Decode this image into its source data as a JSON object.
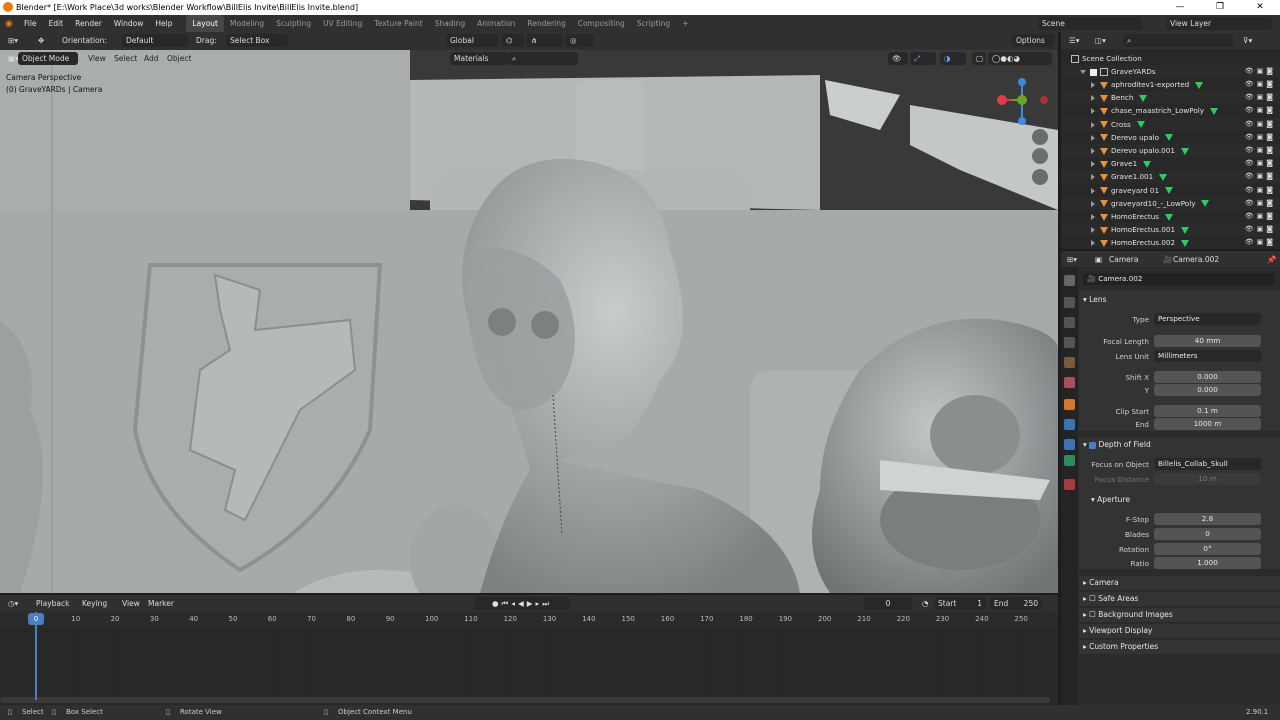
{
  "window": {
    "title": "Blender* [E:\\Work Place\\3d works\\Blender Workflow\\BillElis Invite\\BillElis Invite.blend]",
    "controls": [
      "—",
      "❐",
      "✕"
    ]
  },
  "menubar": {
    "menus": [
      "File",
      "Edit",
      "Render",
      "Window",
      "Help"
    ],
    "workspaces": [
      "Layout",
      "Modeling",
      "Sculpting",
      "UV Editing",
      "Texture Paint",
      "Shading",
      "Animation",
      "Rendering",
      "Compositing",
      "Scripting"
    ],
    "active_workspace": "Layout",
    "add_tab": "+",
    "scene": "Scene",
    "view_layer": "View Layer"
  },
  "viewport_header": {
    "orientation_label": "Orientation:",
    "orientation_value": "Default",
    "drag_label": "Drag:",
    "drag_value": "Select Box",
    "transform_orientation": "Global",
    "options": "Options",
    "mode": "Object Mode",
    "menus": [
      "View",
      "Select",
      "Add",
      "Object"
    ],
    "materials": "Materials"
  },
  "viewport": {
    "info_line1": "Camera Perspective",
    "info_line2": "(0) GraveYARDs | Camera",
    "gizmo_colors": {
      "x": "#e23b47",
      "y": "#6aa81f",
      "z": "#3b8be0"
    }
  },
  "outliner": {
    "root": "Scene Collection",
    "collection": "GraveYARDs",
    "items": [
      "aphroditev1-exported",
      "Bench",
      "chase_maastrich_LowPoly",
      "Cross",
      "Derevo upalo",
      "Derevo upalo.001",
      "Grave1",
      "Grave1.001",
      "graveyard 01",
      "graveyard10_-_LowPoly",
      "HomoErectus",
      "HomoErectus.001",
      "HomoErectus.002"
    ],
    "icon_color": "#e8903a",
    "mesh_color": "#2ccd5e"
  },
  "properties": {
    "breadcrumb_object": "Camera",
    "breadcrumb_data": "Camera.002",
    "datablock": "Camera.002",
    "lens_section": "Lens",
    "type_label": "Type",
    "type_value": "Perspective",
    "focal_label": "Focal Length",
    "focal_value": "40 mm",
    "lens_unit_label": "Lens Unit",
    "lens_unit_value": "Millimeters",
    "shift_x_label": "Shift X",
    "shift_x_value": "0.000",
    "shift_y_label": "Y",
    "shift_y_value": "0.000",
    "clip_start_label": "Clip Start",
    "clip_start_value": "0.1 m",
    "clip_end_label": "End",
    "clip_end_value": "1000 m",
    "dof_section": "Depth of Field",
    "focus_object_label": "Focus on Object",
    "focus_object_value": "Billelis_Collab_Skull",
    "focus_distance_label": "Focus Distance",
    "focus_distance_value": "10 m",
    "aperture_section": "Aperture",
    "fstop_label": "F-Stop",
    "fstop_value": "2.8",
    "blades_label": "Blades",
    "blades_value": "0",
    "rotation_label": "Rotation",
    "rotation_value": "0°",
    "ratio_label": "Ratio",
    "ratio_value": "1.000",
    "collapsed_sections": [
      "Camera",
      "Safe Areas",
      "Background Images",
      "Viewport Display",
      "Custom Properties"
    ]
  },
  "timeline": {
    "menus": [
      "Playback",
      "Keying",
      "View",
      "Marker"
    ],
    "current_frame": "0",
    "start_label": "Start",
    "start_value": "1",
    "end_label": "End",
    "end_value": "250",
    "ticks": [
      "0",
      "10",
      "20",
      "30",
      "40",
      "50",
      "60",
      "70",
      "80",
      "90",
      "100",
      "110",
      "120",
      "130",
      "140",
      "150",
      "160",
      "170",
      "180",
      "190",
      "200",
      "210",
      "220",
      "230",
      "240",
      "250"
    ]
  },
  "statusbar": {
    "select": "Select",
    "box_select": "Box Select",
    "rotate_view": "Rotate View",
    "context_menu": "Object Context Menu",
    "version": "2.90.1"
  }
}
